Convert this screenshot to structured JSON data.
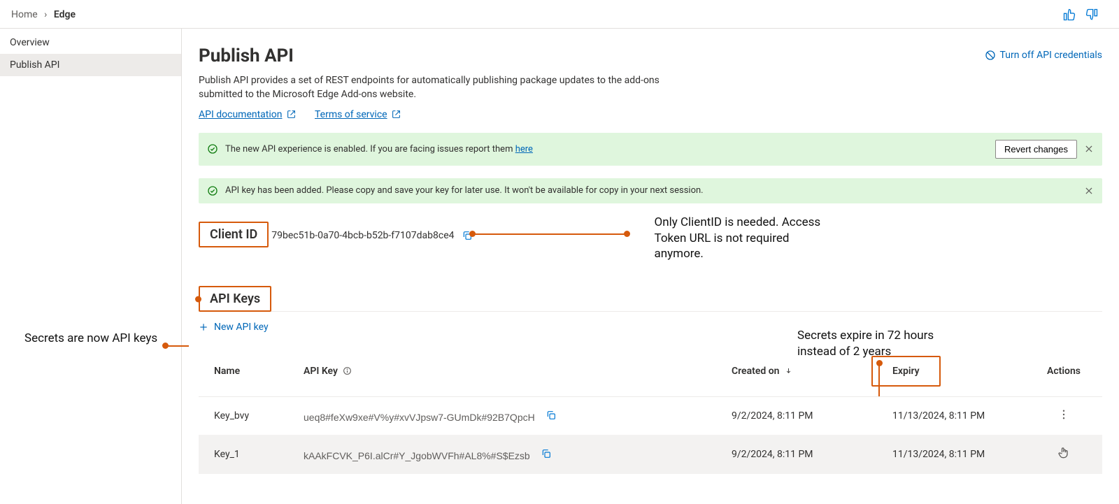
{
  "breadcrumb": {
    "home": "Home",
    "current": "Edge"
  },
  "sidebar": {
    "items": [
      {
        "label": "Overview"
      },
      {
        "label": "Publish API"
      }
    ]
  },
  "header": {
    "title": "Publish API",
    "turn_off": "Turn off API credentials",
    "lede": "Publish API provides a set of REST endpoints for automatically publishing package updates to the add-ons submitted to the Microsoft Edge Add-ons website.",
    "link_docs": "API documentation",
    "link_tos": "Terms of service"
  },
  "banners": {
    "enabled_prefix": "The new API experience is enabled. If you are facing issues report them ",
    "enabled_link": "here",
    "revert_btn": "Revert changes",
    "added": "API key has been added. Please copy and save your key for later use. It won't be available for copy in your next session."
  },
  "client": {
    "heading": "Client ID",
    "value": "79bec51b-0a70-4bcb-b52b-f7107dab8ce4"
  },
  "annotations": {
    "clientid_note": "Only ClientID is needed. Access Token URL is not required anymore.",
    "apikeys_note": "Secrets are now API keys",
    "expiry_note": "Secrets expire in 72 hours instead of 2 years"
  },
  "apikeys": {
    "heading": "API Keys",
    "new_key": "New API key",
    "columns": {
      "name": "Name",
      "api_key": "API Key",
      "created": "Created on",
      "expiry": "Expiry",
      "actions": "Actions"
    },
    "rows": [
      {
        "name": "Key_bvy",
        "key": "ueq8#feXw9xe#V%y#xvVJpsw7-GUmDk#92B7QpcH",
        "created": "9/2/2024, 8:11 PM",
        "expiry": "11/13/2024, 8:11 PM"
      },
      {
        "name": "Key_1",
        "key": "kAAkFCVK_P6I.alCr#Y_JgobWVFh#AL8%#S$Ezsb",
        "created": "9/2/2024, 8:11 PM",
        "expiry": "11/13/2024, 8:11 PM"
      }
    ]
  }
}
